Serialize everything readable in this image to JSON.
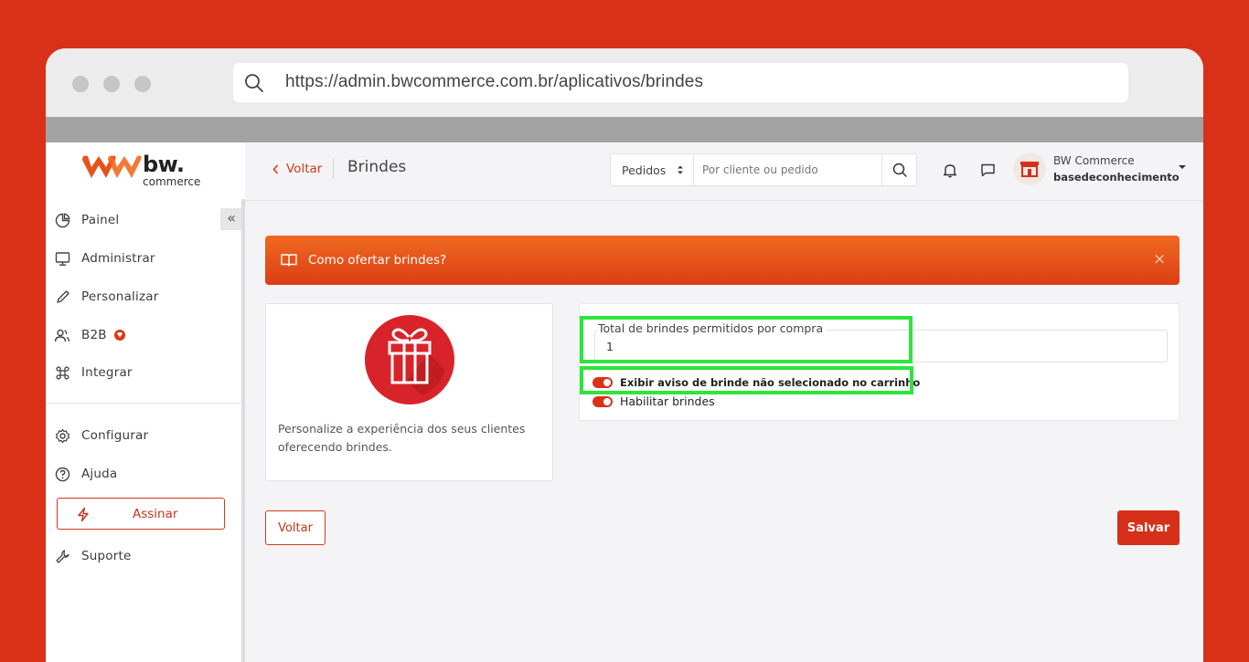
{
  "browser": {
    "url": "https://admin.bwcommerce.com.br/aplicativos/brindes",
    "window_dot_color": "#c6c6c6"
  },
  "brand": {
    "name": "bw.",
    "sub": "commerce",
    "accent": "#d43a1c",
    "background": "#d93118"
  },
  "sidebar": {
    "collapse_label": "«",
    "items": [
      {
        "label": "Painel",
        "icon": "pie-chart-icon"
      },
      {
        "label": "Administrar",
        "icon": "monitor-icon"
      },
      {
        "label": "Personalizar",
        "icon": "pencil-icon"
      },
      {
        "label": "B2B",
        "icon": "users-icon"
      },
      {
        "label": "Integrar",
        "icon": "command-icon"
      },
      {
        "label": "Configurar",
        "icon": "gear-icon"
      },
      {
        "label": "Ajuda",
        "icon": "help-circle-icon"
      },
      {
        "label": "Suporte",
        "icon": "wrench-icon"
      }
    ],
    "cta": {
      "label": "Assinar",
      "icon": "lightning-icon"
    }
  },
  "header": {
    "back_label": "Voltar",
    "title": "Brindes",
    "search_select": "Pedidos",
    "search_placeholder": "Por cliente ou pedido",
    "profile_name": "BW Commerce",
    "profile_store": "basedeconhecimento"
  },
  "banner": {
    "text": "Como ofertar brindes?",
    "close": "×",
    "icon": "book-icon"
  },
  "app_card": {
    "icon": "gift-icon",
    "description": "Personalize a experiência dos seus clientes oferecendo brindes."
  },
  "settings": {
    "total_label": "Total de brindes permitidos por compra",
    "total_value": "1",
    "toggle_aviso_label": "Exibir aviso de brinde não selecionado no carrinho",
    "toggle_aviso_on": true,
    "toggle_habilitar_label": "Habilitar brindes",
    "toggle_habilitar_on": true,
    "highlight_color": "#2ee43d"
  },
  "footer": {
    "back_label": "Voltar",
    "save_label": "Salvar"
  }
}
